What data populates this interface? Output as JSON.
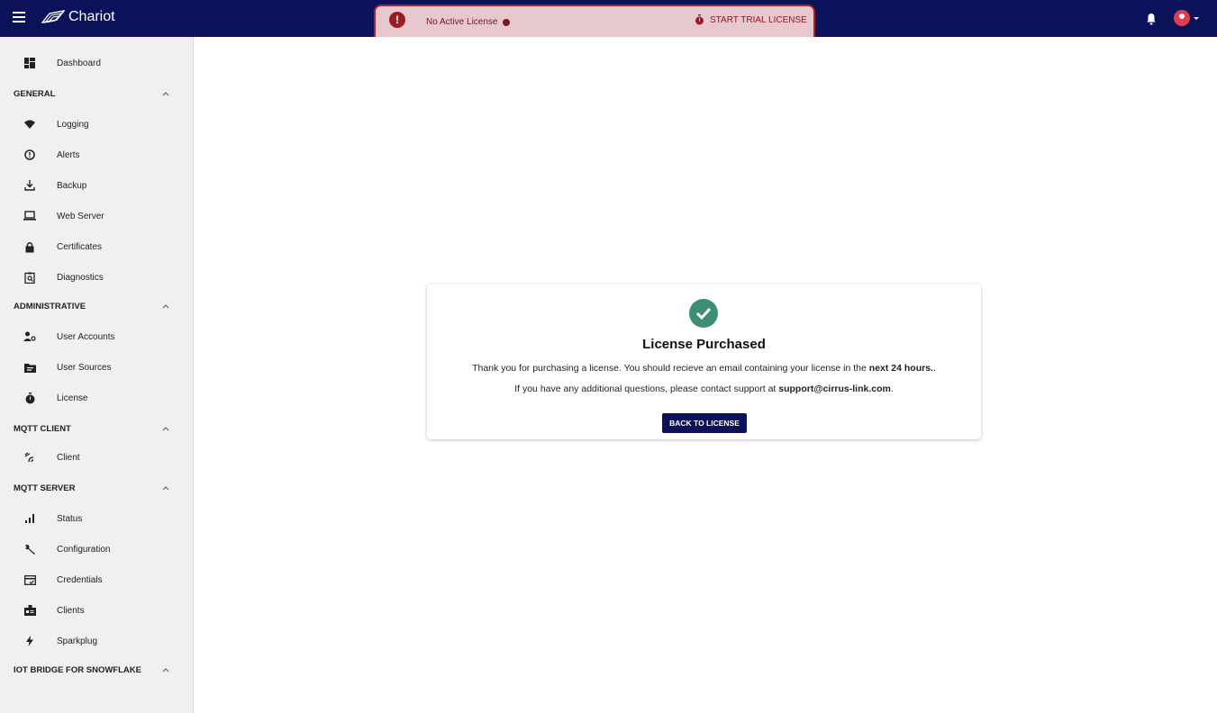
{
  "app": {
    "name": "Chariot"
  },
  "banner": {
    "status_text": "No Active License",
    "trial_button": "START TRIAL LICENSE"
  },
  "sidebar": {
    "dashboard": "Dashboard",
    "sections": [
      {
        "label": "GENERAL",
        "items": [
          "Logging",
          "Alerts",
          "Backup",
          "Web Server",
          "Certificates",
          "Diagnostics"
        ]
      },
      {
        "label": "ADMINISTRATIVE",
        "items": [
          "User Accounts",
          "User Sources",
          "License"
        ]
      },
      {
        "label": "MQTT CLIENT",
        "items": [
          "Client"
        ]
      },
      {
        "label": "MQTT SERVER",
        "items": [
          "Status",
          "Configuration",
          "Credentials",
          "Clients",
          "Sparkplug"
        ]
      },
      {
        "label": "IOT BRIDGE FOR SNOWFLAKE",
        "items": []
      }
    ]
  },
  "card": {
    "title": "License Purchased",
    "line1_pre": "Thank you for purchasing a license. You should recieve an email containing your license in the ",
    "line1_bold": "next 24 hours.",
    "line1_post": ".",
    "line2_pre": "If you have any additional questions, please contact support at ",
    "line2_bold": "support@cirrus-link.com",
    "line2_post": ".",
    "button": "BACK TO LICENSE"
  },
  "colors": {
    "navy": "#0b1259",
    "banner_bg": "#e8c8cf",
    "banner_border": "#b0202a",
    "success": "#3e8e72",
    "avatar": "#e23b4f"
  }
}
